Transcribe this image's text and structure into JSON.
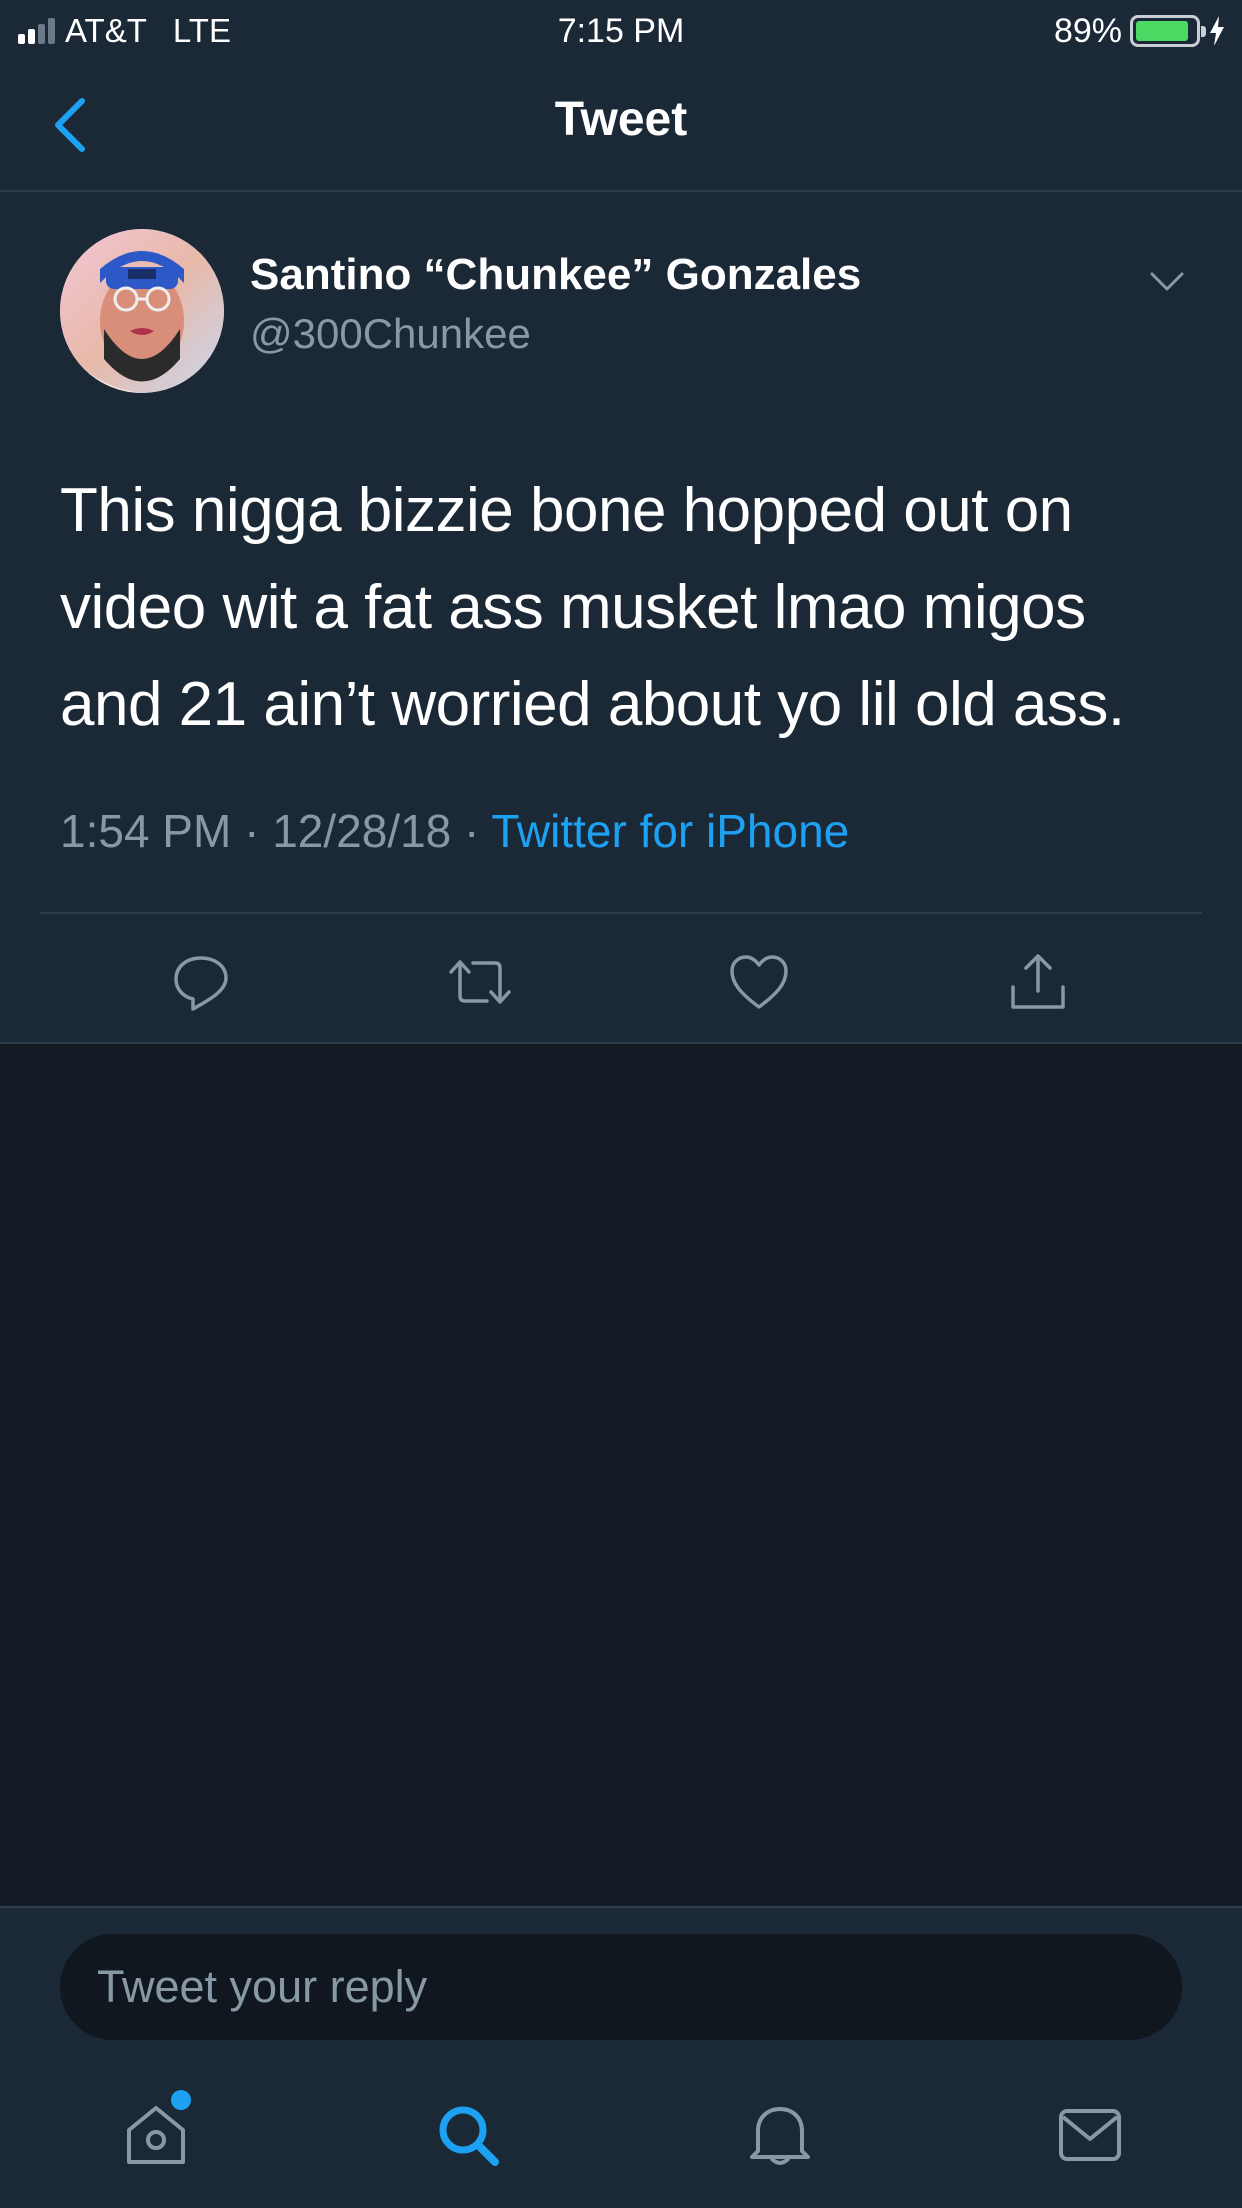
{
  "status_bar": {
    "carrier": "AT&T",
    "network": "LTE",
    "time": "7:15 PM",
    "battery_percent": "89%",
    "battery_level": 0.89,
    "battery_color": "#4cd964"
  },
  "nav": {
    "title": "Tweet",
    "back_icon": "chevron-left-icon"
  },
  "tweet": {
    "author_name": "Santino “Chunkee” Gonzales",
    "author_handle": "@300Chunkee",
    "text": "This nigga bizzie bone hopped out on video wit a fat ass musket lmao migos and 21 ain’t worried about yo lil old ass.",
    "time": "1:54 PM",
    "date": "12/28/18",
    "separator": "·",
    "source": "Twitter for iPhone",
    "more_icon": "chevron-down-icon"
  },
  "actions": [
    {
      "icon": "reply-icon"
    },
    {
      "icon": "retweet-icon"
    },
    {
      "icon": "like-icon"
    },
    {
      "icon": "share-icon"
    }
  ],
  "reply": {
    "placeholder": "Tweet your reply"
  },
  "tabs": [
    {
      "icon": "home-icon",
      "has_notification": true
    },
    {
      "icon": "search-icon",
      "active": true
    },
    {
      "icon": "notifications-icon"
    },
    {
      "icon": "messages-icon"
    }
  ],
  "colors": {
    "accent": "#1da1f2",
    "background": "#141d26",
    "panel": "#1b2836",
    "secondary_text": "#8899a6"
  }
}
